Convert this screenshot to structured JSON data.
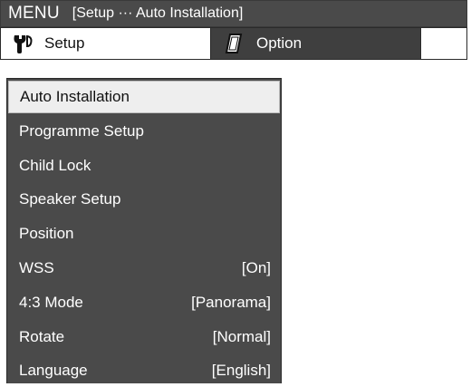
{
  "header": {
    "menu_label": "MENU",
    "breadcrumb": "[Setup ··· Auto Installation]"
  },
  "tabs": [
    {
      "label": "Setup",
      "icon": "wrench-icon",
      "active": true
    },
    {
      "label": "Option",
      "icon": "card-icon",
      "active": false
    }
  ],
  "menu": {
    "items": [
      {
        "label": "Auto Installation",
        "value": "",
        "selected": true
      },
      {
        "label": "Programme Setup",
        "value": ""
      },
      {
        "label": "Child Lock",
        "value": ""
      },
      {
        "label": "Speaker Setup",
        "value": ""
      },
      {
        "label": "Position",
        "value": ""
      },
      {
        "label": "WSS",
        "value": "[On]"
      },
      {
        "label": "4:3 Mode",
        "value": "[Panorama]"
      },
      {
        "label": "Rotate",
        "value": "[Normal]"
      },
      {
        "label": "Language",
        "value": "[English]"
      }
    ]
  },
  "colors": {
    "panel_bg": "#4a4a4a",
    "selected_bg": "#eeeeee",
    "active_tab_bg": "#ffffff",
    "inactive_tab_bg": "#3f3f3f"
  }
}
